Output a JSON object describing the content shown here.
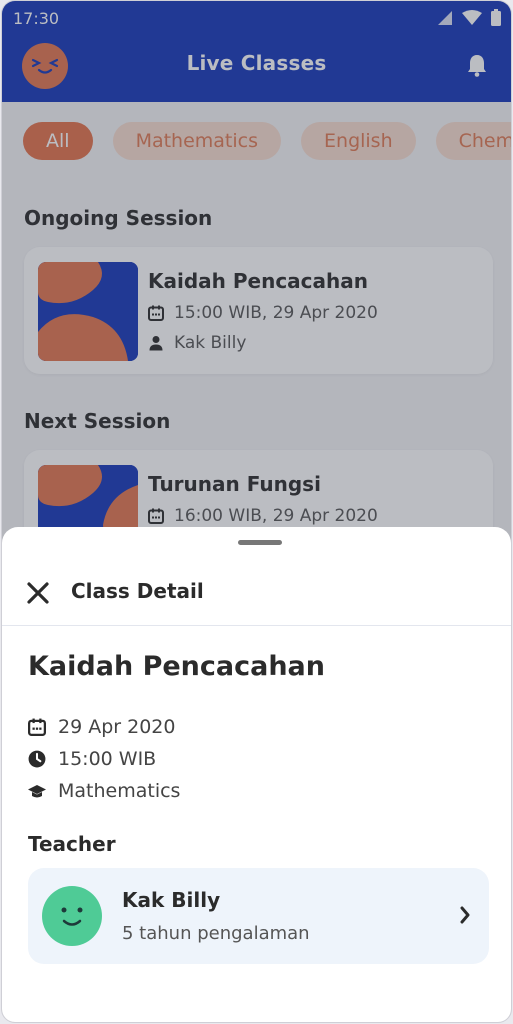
{
  "status_bar": {
    "time": "17:30"
  },
  "header": {
    "title": "Live Classes"
  },
  "filters": [
    "All",
    "Mathematics",
    "English",
    "Chemistry"
  ],
  "ongoing": {
    "heading": "Ongoing Session",
    "title": "Kaidah Pencacahan",
    "time": "15:00 WIB, 29 Apr 2020",
    "teacher": "Kak Billy"
  },
  "next": {
    "heading": "Next Session",
    "title": "Turunan Fungsi",
    "time": "16:00 WIB, 29 Apr 2020"
  },
  "sheet": {
    "title": "Class Detail",
    "class_title": "Kaidah Pencacahan",
    "date": "29 Apr 2020",
    "time": "15:00 WIB",
    "subject": "Mathematics",
    "teacher_label": "Teacher",
    "teacher_name": "Kak Billy",
    "teacher_experience": "5 tahun pengalaman"
  },
  "colors": {
    "primary": "#1638b9",
    "accent": "#e4724b",
    "teacher_avatar": "#4fcb96"
  }
}
